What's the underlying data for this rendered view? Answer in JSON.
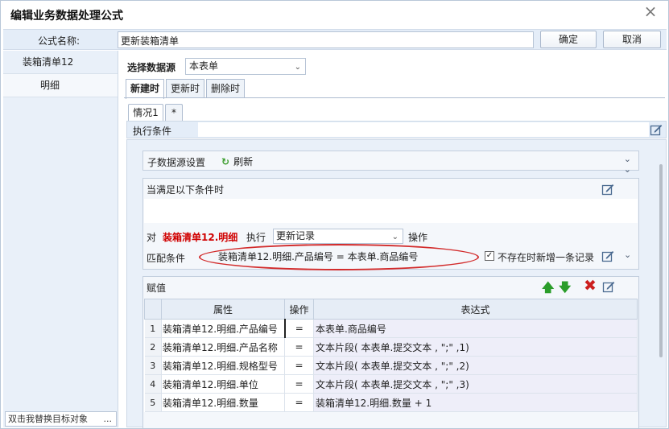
{
  "window": {
    "title": "编辑业务数据处理公式",
    "close_glyph": "×"
  },
  "namebar": {
    "label": "公式名称:",
    "value": "更新装箱清单",
    "ok": "确定",
    "cancel": "取消"
  },
  "tree": {
    "items": [
      "装箱清单12",
      "明细"
    ],
    "replace_hint": "双击我替换目标对象",
    "replace_dots": "..."
  },
  "datasource": {
    "label": "选择数据源",
    "value": "本表单"
  },
  "tabs": [
    "新建时",
    "更新时",
    "删除时"
  ],
  "subtabs": [
    "情况1",
    "*"
  ],
  "condition": {
    "label": "执行条件",
    "value": ""
  },
  "sub_source": {
    "title": "子数据源设置",
    "refresh": "刷新",
    "refresh_icon": "↻"
  },
  "when": {
    "title": "当满足以下条件时",
    "dui": "对",
    "target": "装箱清单12.明细",
    "exec": "执行",
    "action": "更新记录",
    "after": "操作",
    "match_label": "匹配条件",
    "match_text": "装箱清单12.明细.产品编号  =  本表单.商品编号",
    "checkbox_checked": true,
    "checkbox_label": "不存在时新增一条记录"
  },
  "assign": {
    "title": "赋值",
    "columns": [
      "属性",
      "操作",
      "表达式"
    ],
    "rows": [
      {
        "num": "1",
        "attr": "装箱清单12.明细.产品编号",
        "op": "=",
        "expr": "本表单.商品编号"
      },
      {
        "num": "2",
        "attr": "装箱清单12.明细.产品名称",
        "op": "=",
        "expr": "文本片段( 本表单.提交文本 , \";\" ,1)"
      },
      {
        "num": "3",
        "attr": "装箱清单12.明细.规格型号",
        "op": "=",
        "expr": "文本片段( 本表单.提交文本 , \";\" ,2)"
      },
      {
        "num": "4",
        "attr": "装箱清单12.明细.单位",
        "op": "=",
        "expr": "文本片段( 本表单.提交文本 , \";\" ,3)"
      },
      {
        "num": "5",
        "attr": "装箱清单12.明细.数量",
        "op": "=",
        "expr": "装箱清单12.明细.数量  + 1"
      }
    ]
  },
  "colors": {
    "accent_red": "#d00000",
    "ellipse": "#d22b2b",
    "green": "#2a9d2a"
  }
}
